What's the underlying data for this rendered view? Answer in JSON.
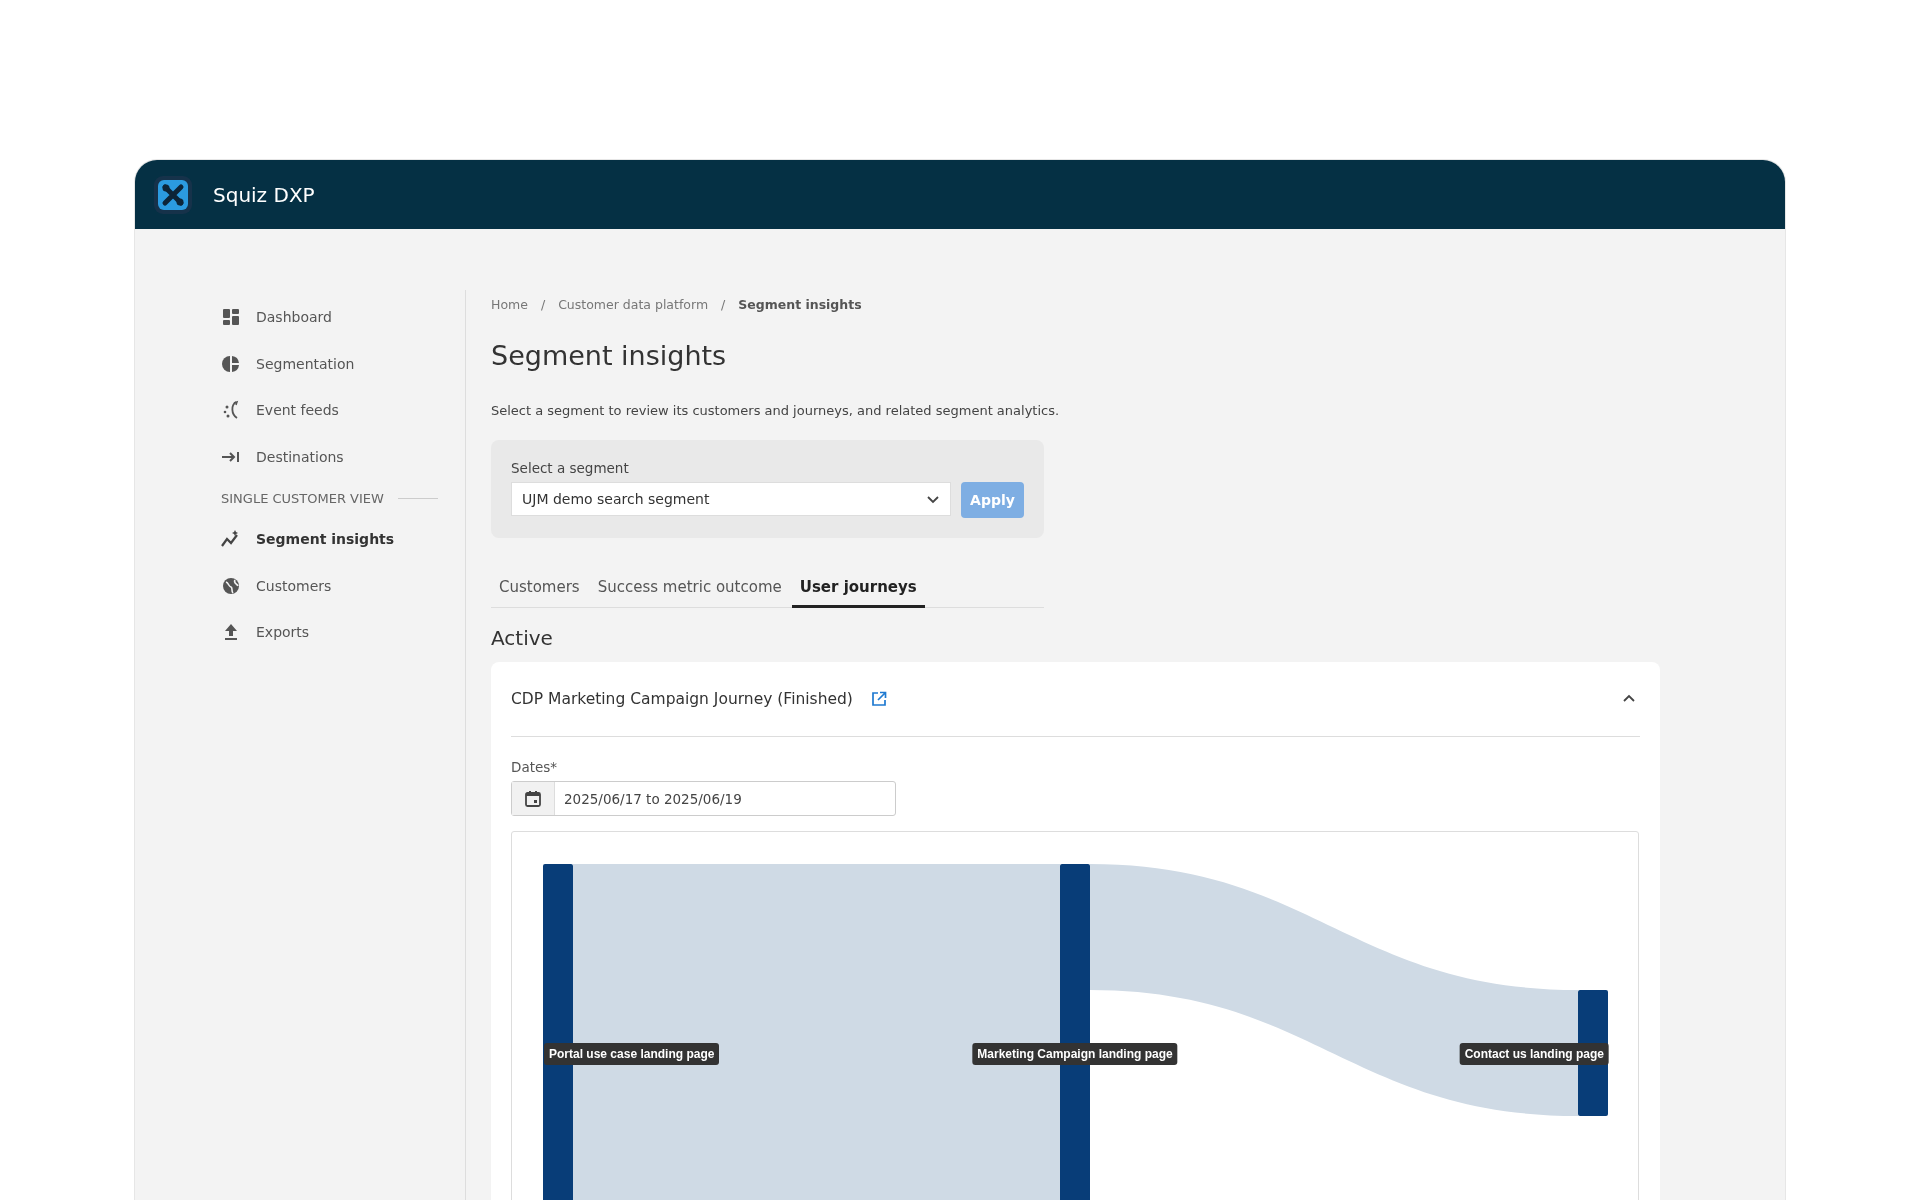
{
  "app": {
    "title": "Squiz DXP"
  },
  "sidebar": {
    "items": [
      {
        "kind": "link",
        "label": "Dashboard",
        "selected": false
      },
      {
        "kind": "link",
        "label": "Segmentation",
        "selected": false
      },
      {
        "kind": "link",
        "label": "Event feeds",
        "selected": false
      },
      {
        "kind": "link",
        "label": "Destinations",
        "selected": false
      },
      {
        "kind": "section",
        "label": "SINGLE CUSTOMER VIEW"
      },
      {
        "kind": "link",
        "label": "Segment insights",
        "selected": true
      },
      {
        "kind": "link",
        "label": "Customers",
        "selected": false
      },
      {
        "kind": "link",
        "label": "Exports",
        "selected": false
      }
    ]
  },
  "breadcrumb": [
    {
      "kind": "link",
      "label": "Home"
    },
    {
      "kind": "separator",
      "label": "/"
    },
    {
      "kind": "link",
      "label": "Customer data platform"
    },
    {
      "kind": "separator",
      "label": "/"
    },
    {
      "kind": "current",
      "label": "Segment insights"
    }
  ],
  "page": {
    "title": "Segment insights",
    "description": "Select a segment to review its customers and journeys, and related segment analytics."
  },
  "segment_picker": {
    "label": "Select a segment",
    "value": "UJM demo search segment",
    "apply": {
      "label": "Apply",
      "disabled": true
    }
  },
  "tabs": [
    {
      "label": "Customers",
      "selected": false
    },
    {
      "label": "Success metric outcome",
      "selected": false
    },
    {
      "label": "User journeys",
      "selected": true
    }
  ],
  "section_title": "Active",
  "journey": {
    "title": "CDP Marketing Campaign Journey (Finished)",
    "expanded": true,
    "dates_label": "Dates*",
    "dates_value": "2025/06/17 to 2025/06/19",
    "sankey": {
      "nodes": [
        {
          "label": "Portal use case landing page"
        },
        {
          "label": "Marketing Campaign landing page"
        },
        {
          "label": "Contact us landing page"
        }
      ]
    }
  }
}
